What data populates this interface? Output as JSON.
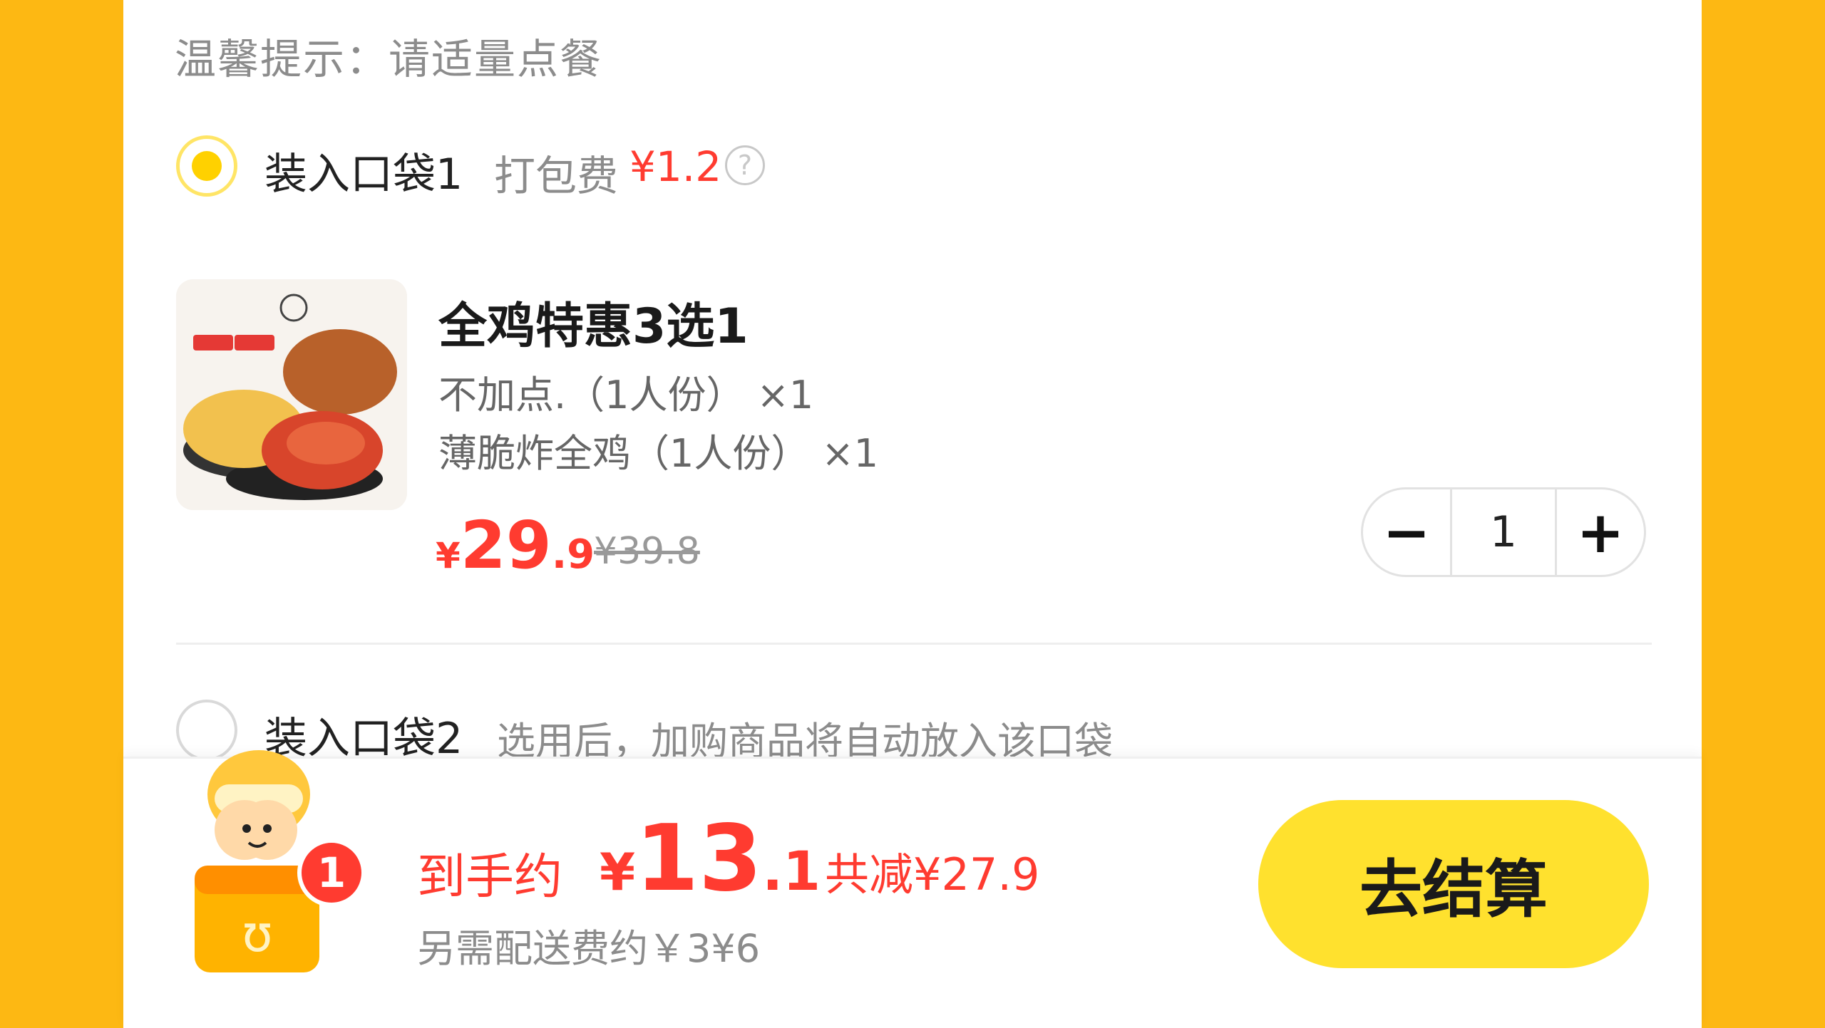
{
  "tip": "温馨提示：请适量点餐",
  "bag1": {
    "label": "装入口袋1",
    "pack_fee_label": "打包费",
    "pack_fee_price": "¥1.2",
    "help_icon": "question-circle-icon",
    "checked": true
  },
  "product": {
    "image": "roast-chicken-thumbnail",
    "name": "全鸡特惠3选1",
    "options": [
      "不加点.（1人份） ×1",
      "薄脆炸全鸡（1人份） ×1"
    ],
    "price_currency": "¥",
    "price_int": "29",
    "price_dec": ".9",
    "original_price": "¥39.8",
    "quantity": "1",
    "minus_label": "−",
    "plus_label": "+"
  },
  "bag2": {
    "label": "装入口袋2",
    "hint": "选用后，加购商品将自动放入该口袋",
    "checked": false
  },
  "bottom": {
    "mascot": "delivery-mascot",
    "cart_count": "1",
    "estimate_label": "到手约",
    "estimate_currency": "¥",
    "estimate_int": "13",
    "estimate_dec": ".1",
    "saved": "共减¥27.9",
    "delivery_fee": "另需配送费约￥3¥6",
    "checkout_label": "去结算"
  },
  "colors": {
    "background": "#FDB813",
    "accent_yellow": "#FFD100",
    "price_red": "#FF3B30",
    "checkout_yellow": "#FFE12E"
  }
}
